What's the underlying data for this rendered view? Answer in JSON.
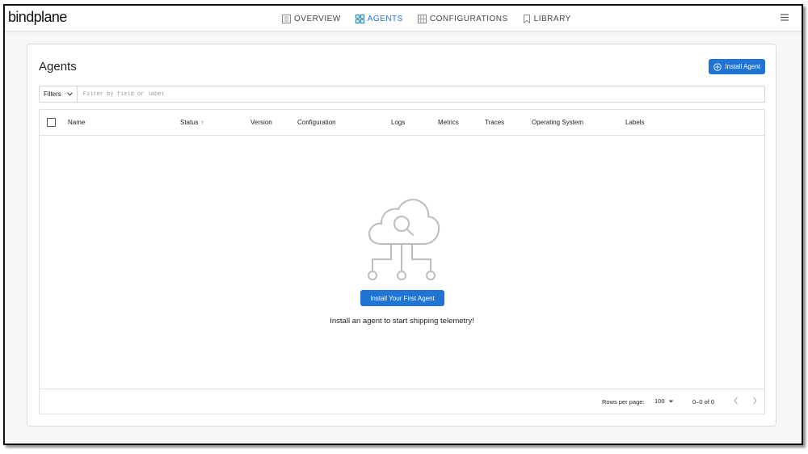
{
  "app": {
    "logo": "bindplane"
  },
  "nav": {
    "items": [
      {
        "label": "OVERVIEW",
        "icon": "overview-icon",
        "active": false
      },
      {
        "label": "AGENTS",
        "icon": "agents-grid-icon",
        "active": true
      },
      {
        "label": "CONFIGURATIONS",
        "icon": "configurations-icon",
        "active": false
      },
      {
        "label": "LIBRARY",
        "icon": "bookmark-icon",
        "active": false
      }
    ]
  },
  "page": {
    "title": "Agents",
    "install_button": "Install Agent"
  },
  "filters": {
    "button_label": "Filters",
    "placeholder": "Filter by field or label"
  },
  "table": {
    "columns": [
      "Name",
      "Status",
      "Version",
      "Configuration",
      "Logs",
      "Metrics",
      "Traces",
      "Operating System",
      "Labels"
    ],
    "sorted_column": "Status",
    "sort_direction": "ascending",
    "rows": []
  },
  "empty_state": {
    "button_label": "Install Your First Agent",
    "message": "Install an agent to start shipping telemetry!"
  },
  "pagination": {
    "rows_per_page_label": "Rows per page:",
    "rows_per_page_value": "100",
    "range_text": "0–0 of 0"
  },
  "colors": {
    "accent": "#1f74d4",
    "illustration": "#bdbdbd"
  }
}
